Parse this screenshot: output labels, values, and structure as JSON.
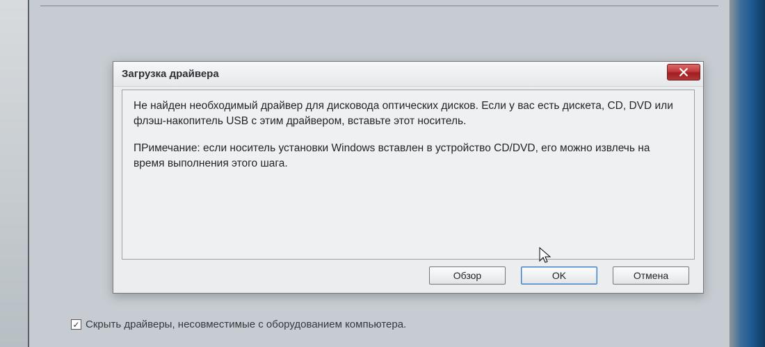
{
  "dialog": {
    "title": "Загрузка драйвера",
    "message1": "Не найден необходимый драйвер для дисковода оптических дисков. Если у вас есть дискета, CD, DVD или флэш-накопитель USB с этим драйвером, вставьте этот носитель.",
    "message2": "ПРимечание: если носитель установки Windows вставлен в устройство CD/DVD, его можно извлечь на время выполнения этого шага.",
    "buttons": {
      "browse": "Обзор",
      "ok": "OK",
      "cancel": "Отмена"
    }
  },
  "parent": {
    "hide_incompatible_label": "Скрыть драйверы, несовместимые с оборудованием компьютера.",
    "hide_incompatible_checked": true
  }
}
